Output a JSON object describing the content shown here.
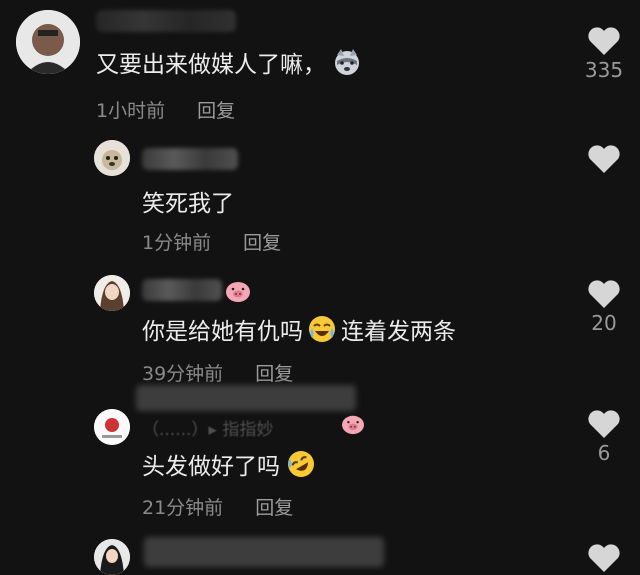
{
  "comments": [
    {
      "text": "又要出来做媒人了嘛，",
      "time": "1小时前",
      "reply": "回复",
      "likes": "335",
      "emoji": "wolf-emoji"
    },
    {
      "text": "笑死我了",
      "time": "1分钟前",
      "reply": "回复",
      "likes": "",
      "emoji": ""
    },
    {
      "text_a": "你是给她有仇吗",
      "text_b": "连着发两条",
      "time": "39分钟前",
      "reply": "回复",
      "likes": "20",
      "emoji": "laugh-cry-emoji",
      "name_emoji": "pig-emoji"
    },
    {
      "text": "头发做好了吗",
      "time": "21分钟前",
      "reply": "回复",
      "likes": "6",
      "emoji": "rofl-emoji",
      "name_partial": "（......）▸ 指指妙",
      "name_emoji": "pig-emoji"
    },
    {
      "text": "",
      "time": "",
      "reply": "",
      "likes": "",
      "emoji": ""
    }
  ],
  "colors": {
    "background": "#121212",
    "text": "#ececec",
    "meta": "#8a8a8a",
    "heart": "#d6d6d6"
  },
  "icons": {
    "like": "heart-icon"
  }
}
